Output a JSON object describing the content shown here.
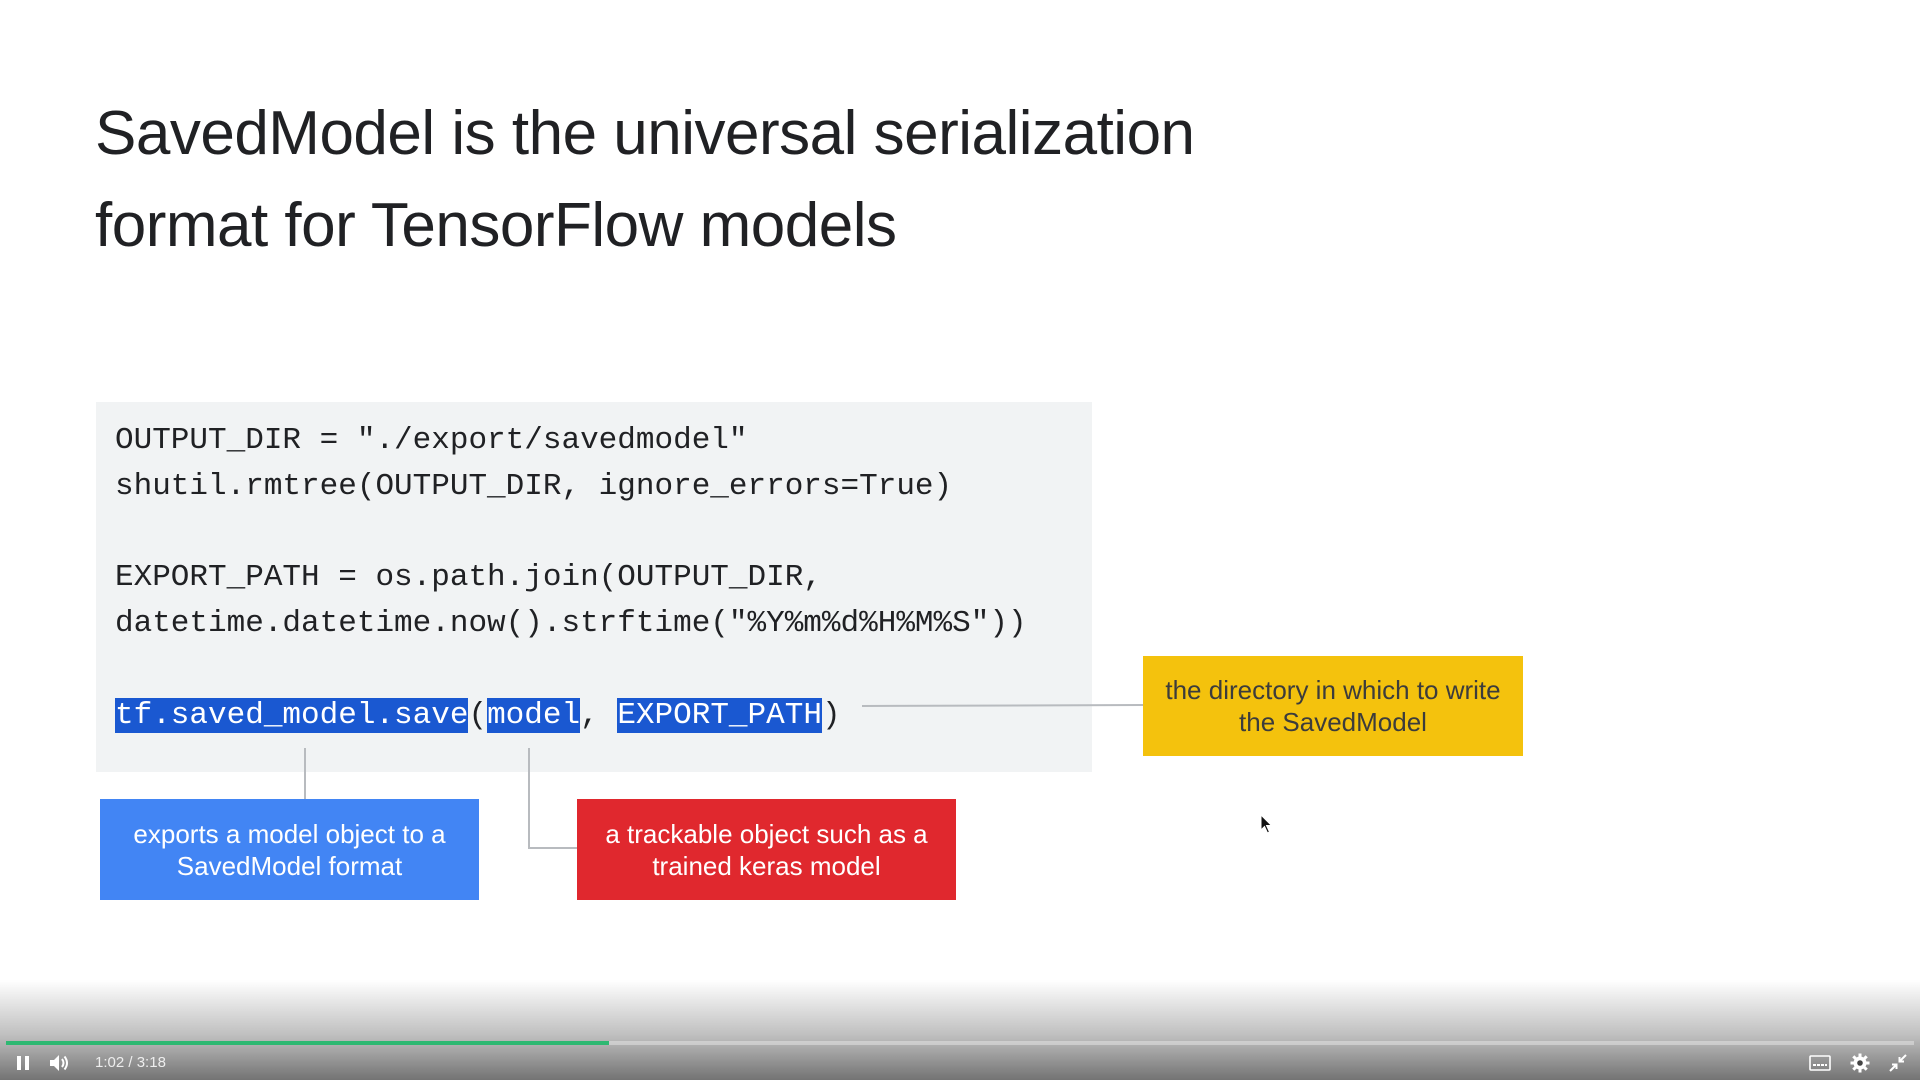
{
  "slide": {
    "title_line1": "SavedModel is the universal serialization",
    "title_line2": "format for TensorFlow models"
  },
  "code": {
    "line1": "OUTPUT_DIR = \"./export/savedmodel\"",
    "line2": "shutil.rmtree(OUTPUT_DIR, ignore_errors=True)",
    "line3": "EXPORT_PATH = os.path.join(OUTPUT_DIR,",
    "line4": "datetime.datetime.now().strftime(\"%Y%m%d%H%M%S\"))",
    "line5": {
      "fn": "tf.saved_model.save",
      "open_paren": "(",
      "arg1": "model",
      "comma": ", ",
      "arg2": "EXPORT_PATH",
      "close_paren": ")"
    }
  },
  "callouts": {
    "blue": "exports a model object to a SavedModel format",
    "red": "a trackable object such as a trained keras model",
    "yellow": "the directory in which to write the SavedModel"
  },
  "colors": {
    "blue": "#4285f4",
    "red": "#e0282e",
    "yellow": "#f4c20d",
    "selection": "#1a58d1",
    "progress": "#2eb872"
  },
  "player": {
    "current_time": "1:02",
    "separator": " / ",
    "duration": "3:18",
    "progress_fraction": 0.316,
    "icons": {
      "play_pause": "pause-icon",
      "volume": "volume-icon",
      "captions": "captions-icon",
      "settings": "gear-icon",
      "fullscreen": "exit-fullscreen-icon"
    }
  }
}
